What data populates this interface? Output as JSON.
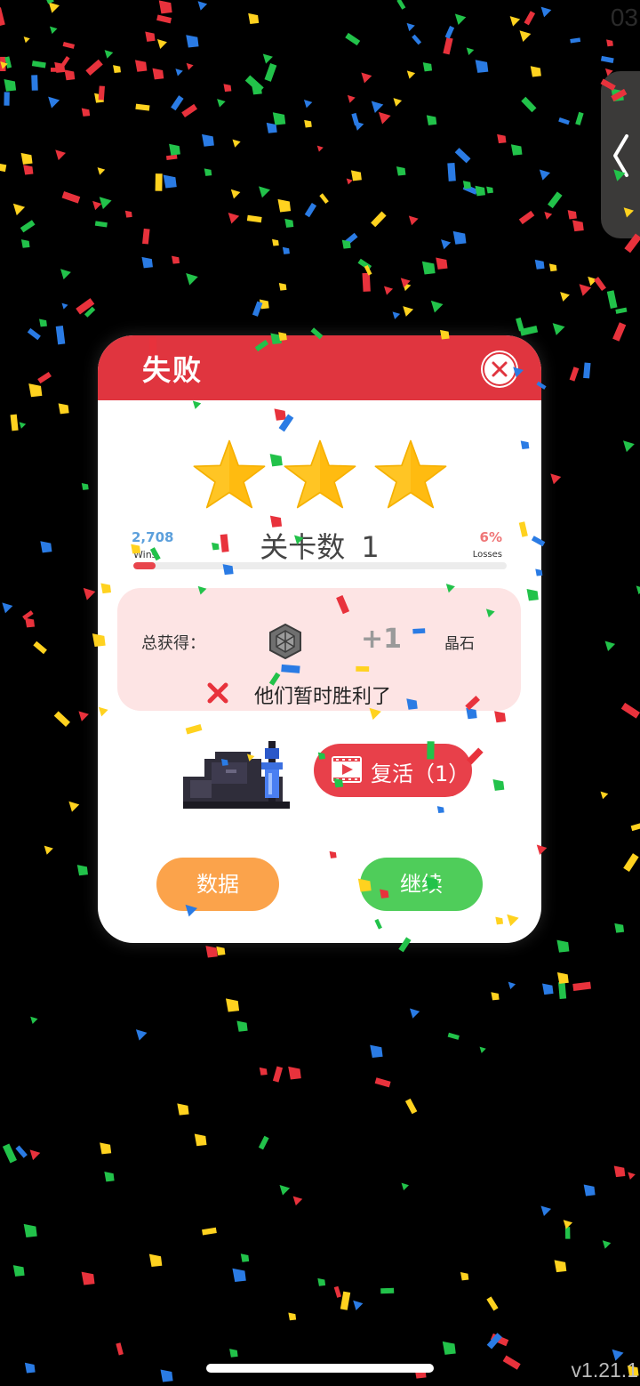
{
  "corner_time": "03",
  "dialog": {
    "title": "失败",
    "stars_filled": 3,
    "stars_total": 3,
    "wins": {
      "value": "2,708",
      "label": "Wins"
    },
    "losses": {
      "value": "6%",
      "label": "Losses"
    },
    "level": {
      "label": "关卡数",
      "number": "1"
    },
    "loss_bar_fraction": 0.06,
    "reward": {
      "label": "总获得：",
      "icon": "gem-icon",
      "amount": "+1",
      "unit": "晶石"
    },
    "result_message": "他们暂时胜利了",
    "revive_button": {
      "label": "复活（1）",
      "icon": "video-ad-icon"
    },
    "stats_button": "数据",
    "continue_button": "继续"
  },
  "version": "v1.21.1",
  "colors": {
    "header_red": "#e0353f",
    "revive_red": "#e8404a",
    "stats_orange": "#fba34b",
    "continue_green": "#4fcd5a",
    "star_yellow": "#ffc524",
    "wins_blue": "#5ca0dc",
    "losses_red": "#ef7677",
    "reward_box_pink": "#fde4e4"
  }
}
